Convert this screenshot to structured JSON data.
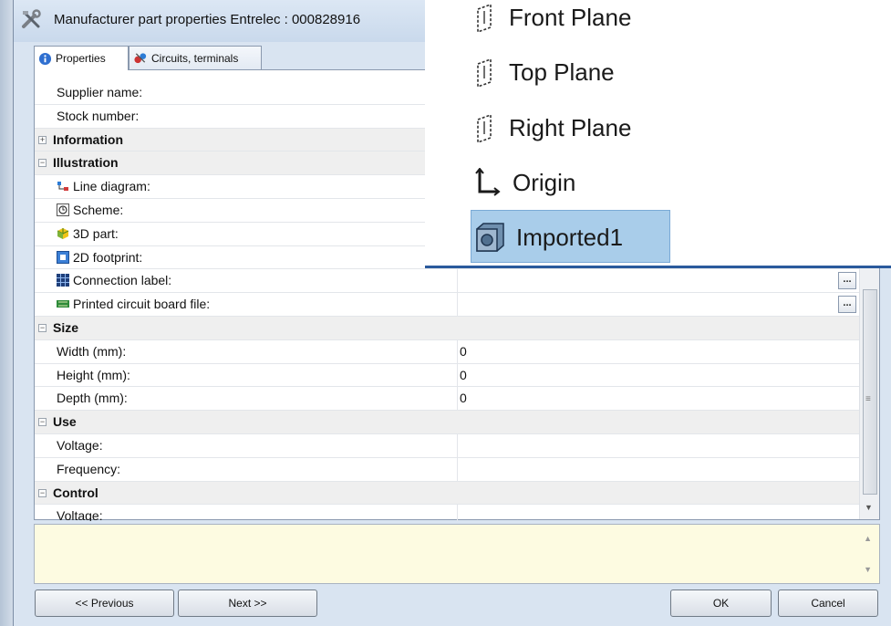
{
  "dialog": {
    "title": "Manufacturer part properties Entrelec : 000828916",
    "tabs": [
      {
        "label": "Properties",
        "icon": "info-icon"
      },
      {
        "label": "Circuits, terminals",
        "icon": "circuits-icon"
      }
    ]
  },
  "properties": {
    "rows": {
      "supplier_name": {
        "name": "Supplier name:",
        "value": ""
      },
      "stock_number": {
        "name": "Stock number:",
        "value": ""
      },
      "information": {
        "name": "Information"
      },
      "illustration": {
        "name": "Illustration"
      },
      "line_diagram": {
        "name": "Line diagram:",
        "icon": "line-diagram-icon"
      },
      "scheme": {
        "name": "Scheme:",
        "icon": "scheme-icon"
      },
      "part_3d": {
        "name": "3D part:",
        "icon": "3d-part-icon"
      },
      "footprint_2d": {
        "name": "2D footprint:",
        "icon": "2d-footprint-icon"
      },
      "connection_label": {
        "name": "Connection label:",
        "icon": "connection-label-icon"
      },
      "pcb_file": {
        "name": "Printed circuit board file:",
        "icon": "pcb-icon"
      },
      "size": {
        "name": "Size"
      },
      "width": {
        "name": "Width (mm):",
        "value": "0"
      },
      "height": {
        "name": "Height (mm):",
        "value": "0"
      },
      "depth": {
        "name": "Depth (mm):",
        "value": "0"
      },
      "use": {
        "name": "Use"
      },
      "use_voltage": {
        "name": "Voltage:",
        "value": ""
      },
      "frequency": {
        "name": "Frequency:",
        "value": ""
      },
      "control": {
        "name": "Control"
      },
      "control_voltage": {
        "name": "Voltage:",
        "value": ""
      }
    },
    "ellipsis_label": "..."
  },
  "buttons": {
    "previous": "<< Previous",
    "next": "Next >>",
    "ok": "OK",
    "cancel": "Cancel"
  },
  "feature_tree": {
    "items": [
      {
        "label": "Front Plane",
        "icon": "plane-icon"
      },
      {
        "label": "Top Plane",
        "icon": "plane-icon"
      },
      {
        "label": "Right Plane",
        "icon": "plane-icon"
      },
      {
        "label": "Origin",
        "icon": "origin-icon"
      },
      {
        "label": "Imported1",
        "icon": "imported-body-icon",
        "selected": true
      }
    ]
  },
  "colors": {
    "selection": "#a9cdea",
    "description_bg": "#fdfbe1",
    "tree_border": "#2a5a9c"
  }
}
